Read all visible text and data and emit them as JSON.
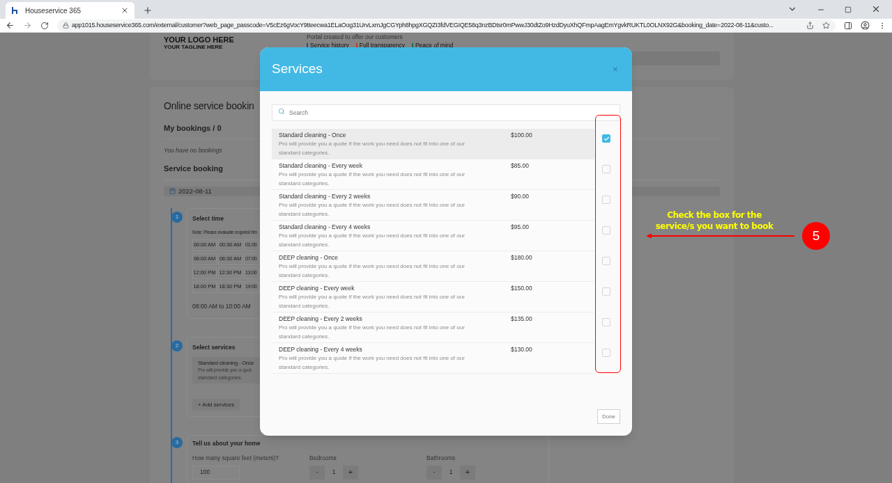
{
  "browser": {
    "tab_title": "Houseservice 365",
    "url": "app1015.houseservice365.com/external/customer?web_page_passcode=V5cEz6gVocY9tteecwa1ELaOog31UrvLxmJgCGYph8hpgXGQZI3fdVEGIQE58q3nzBDtsr0mPwwJ30dtZo9HzdDyuXhQFmpAagEmYgvkRUKTL0OLNX92G&booking_date=2022-08-11&custo..."
  },
  "page": {
    "logo_text": "YOUR LOGO HERE",
    "tagline": "YOUR TAGLINE HERE",
    "portal_text": "Portal created to offer our customers",
    "features": [
      {
        "label": "Service history",
        "color": "#1e4fa0"
      },
      {
        "label": "Full transparency",
        "color": "#c0392b"
      },
      {
        "label": "Peace of mind",
        "color": "#1e6b5a"
      }
    ],
    "booking_title": "Online service bookin",
    "my_bookings": "My bookings / 0",
    "no_bookings": "You have no bookings",
    "service_booking": "Service booking",
    "date": "2022-08-11",
    "step1": {
      "number": "1",
      "title": "Select time",
      "note": "Note: Please evaluate required tim",
      "slots": [
        [
          "00:00 AM",
          "00:30 AM",
          "01:00"
        ],
        [
          "06:00 AM",
          "06:30 AM",
          "07:00"
        ],
        [
          "12:00 PM",
          "12:30 PM",
          "13:00"
        ],
        [
          "18:00 PM",
          "18:30 PM",
          "19:00"
        ]
      ],
      "range": "08:00 AM to 10:00 AM"
    },
    "step2": {
      "number": "2",
      "title": "Select services",
      "service_name": "Standard cleaning - Once",
      "service_line1": "Pro will provide you a quot",
      "service_line2": "standard categories.",
      "add_button": "+ Add services"
    },
    "step3": {
      "number": "3",
      "title": "Tell us about your home",
      "square_feet_label": "How many square feet (meters)?",
      "square_feet_value": "100",
      "counters": [
        {
          "label": "Bedrooms",
          "minus": "-",
          "value": "1",
          "plus": "+"
        },
        {
          "label": "Bathrooms",
          "minus": "-",
          "value": "1",
          "plus": "+"
        }
      ]
    }
  },
  "modal": {
    "title": "Services",
    "close": "×",
    "search": {
      "placeholder": "Search"
    },
    "services": [
      {
        "name": "Standard cleaning - Once",
        "description": "Pro will provide you a quote if the work you need does not fit into one of our standard categories.",
        "price": "$100.00",
        "checked": true
      },
      {
        "name": "Standard cleaning - Every week",
        "description": "Pro will provide you a quote if the work you need does not fit into one of our standard categories.",
        "price": "$85.00",
        "checked": false
      },
      {
        "name": "Standard cleaning - Every 2 weeks",
        "description": "Pro will provide you a quote if the work you need does not fit into one of our standard categories.",
        "price": "$90.00",
        "checked": false
      },
      {
        "name": "Standard cleaning - Every 4 weeks",
        "description": "Pro will provide you a quote if the work you need does not fit into one of our standard categories.",
        "price": "$95.00",
        "checked": false
      },
      {
        "name": "DEEP cleaning - Once",
        "description": "Pro will provide you a quote if the work you need does not fit into one of our standard categories.",
        "price": "$180.00",
        "checked": false
      },
      {
        "name": "DEEP cleaning - Every week",
        "description": "Pro will provide you a quote if the work you need does not fit into one of our standard categories.",
        "price": "$150.00",
        "checked": false
      },
      {
        "name": "DEEP cleaning - Every 2 weeks",
        "description": "Pro will provide you a quote if the work you need does not fit into one of our standard categories.",
        "price": "$135.00",
        "checked": false
      },
      {
        "name": "DEEP cleaning - Every 4 weeks",
        "description": "Pro will provide you a quote if the work you need does not fit into one of our standard categories.",
        "price": "$130.00",
        "checked": false
      }
    ],
    "done": "Done"
  },
  "annotation": {
    "text": "Check the box for the service/s you want to book",
    "badge": "5"
  }
}
